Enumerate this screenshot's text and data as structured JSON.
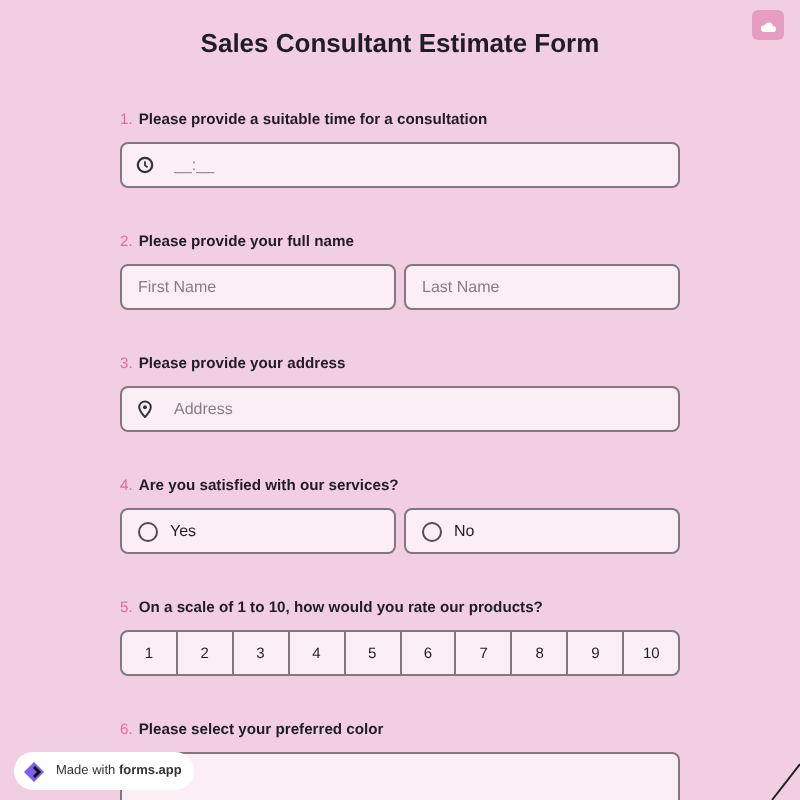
{
  "title": "Sales Consultant Estimate Form",
  "questions": [
    {
      "number": "1.",
      "label": "Please provide a suitable time for a consultation",
      "kind": "time",
      "placeholder": "__:__"
    },
    {
      "number": "2.",
      "label": "Please provide your full name",
      "kind": "name",
      "fields": [
        {
          "placeholder": "First Name"
        },
        {
          "placeholder": "Last Name"
        }
      ]
    },
    {
      "number": "3.",
      "label": "Please provide your address",
      "kind": "address",
      "placeholder": "Address"
    },
    {
      "number": "4.",
      "label": "Are you satisfied with our services?",
      "kind": "radio",
      "options": [
        {
          "label": "Yes",
          "selected": false
        },
        {
          "label": "No",
          "selected": false
        }
      ]
    },
    {
      "number": "5.",
      "label": "On a scale of 1 to 10, how would you rate our products?",
      "kind": "scale",
      "options": [
        {
          "label": "1",
          "selected": false
        },
        {
          "label": "2",
          "selected": false
        },
        {
          "label": "3",
          "selected": false
        },
        {
          "label": "4",
          "selected": false
        },
        {
          "label": "5",
          "selected": false
        },
        {
          "label": "6",
          "selected": false
        },
        {
          "label": "7",
          "selected": false
        },
        {
          "label": "8",
          "selected": false
        },
        {
          "label": "9",
          "selected": false
        },
        {
          "label": "10",
          "selected": false
        }
      ]
    },
    {
      "number": "6.",
      "label": "Please select your preferred color",
      "kind": "textarea"
    }
  ],
  "badge": {
    "text": "Made with **forms.app**"
  }
}
